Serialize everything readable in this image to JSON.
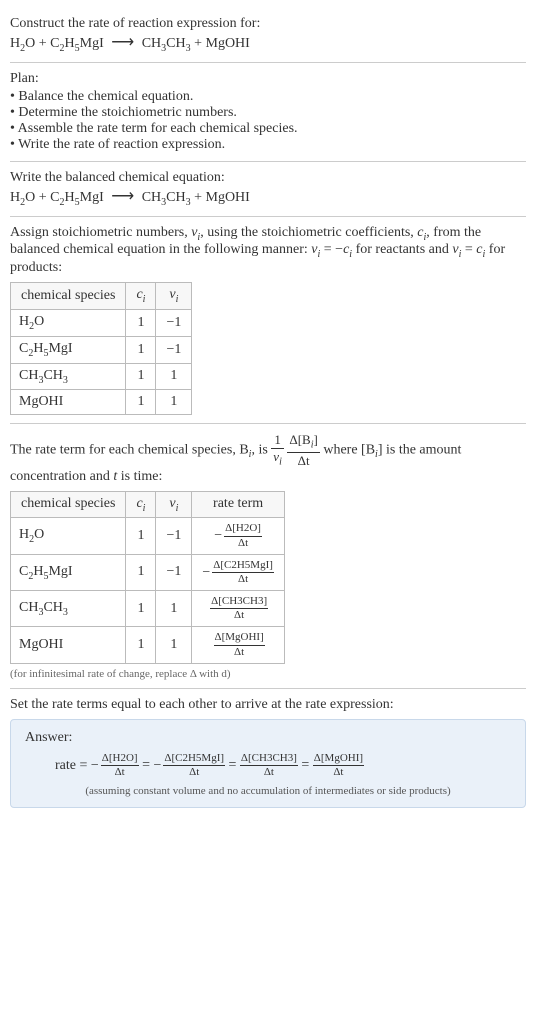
{
  "s1": {
    "heading": "Construct the rate of reaction expression for:",
    "eq_lhs_a": "H",
    "eq_lhs_a_sub": "2",
    "eq_lhs_a_tail": "O",
    "plus1": " + ",
    "eq_lhs_b": "C",
    "eq_lhs_b_sub1": "2",
    "eq_lhs_b_mid": "H",
    "eq_lhs_b_sub2": "5",
    "eq_lhs_b_tail": "MgI",
    "arrow": "⟶",
    "eq_rhs_a": "CH",
    "eq_rhs_a_sub1": "3",
    "eq_rhs_a_mid": "CH",
    "eq_rhs_a_sub2": "3",
    "plus2": " + ",
    "eq_rhs_b": "MgOHI"
  },
  "plan": {
    "heading": "Plan:",
    "items": [
      "Balance the chemical equation.",
      "Determine the stoichiometric numbers.",
      "Assemble the rate term for each chemical species.",
      "Write the rate of reaction expression."
    ]
  },
  "s2": {
    "heading": "Write the balanced chemical equation:"
  },
  "s3": {
    "para_a": "Assign stoichiometric numbers, ",
    "nu": "ν",
    "sub_i": "i",
    "para_b": ", using the stoichiometric coefficients, ",
    "c": "c",
    "para_c": ", from the balanced chemical equation in the following manner: ",
    "eq1_lhs": "ν",
    "eq1_eq": " = −",
    "eq1_rhs": "c",
    "para_d": " for reactants and ",
    "eq2_lhs": "ν",
    "eq2_eq": " = ",
    "eq2_rhs": "c",
    "para_e": " for products:",
    "th1": "chemical species",
    "th2_a": "c",
    "th2_sub": "i",
    "th3_a": "ν",
    "th3_sub": "i",
    "rows": [
      {
        "sp_a": "H",
        "sp_sub1": "2",
        "sp_mid": "O",
        "c": "1",
        "v": "−1"
      },
      {
        "sp_a": "C",
        "sp_sub1": "2",
        "sp_mid": "H",
        "sp_sub2": "5",
        "sp_tail": "MgI",
        "c": "1",
        "v": "−1"
      },
      {
        "sp_a": "CH",
        "sp_sub1": "3",
        "sp_mid": "CH",
        "sp_sub2": "3",
        "c": "1",
        "v": "1"
      },
      {
        "sp_a": "MgOHI",
        "c": "1",
        "v": "1"
      }
    ]
  },
  "s4": {
    "para_a": "The rate term for each chemical species, B",
    "sub_i": "i",
    "para_b": ", is ",
    "frac1_num": "1",
    "frac1_den_a": "ν",
    "frac1_den_sub": "i",
    "frac2_num_a": "Δ[B",
    "frac2_num_sub": "i",
    "frac2_num_b": "]",
    "frac2_den": "Δt",
    "para_c": " where [B",
    "para_d": "] is the amount concentration and ",
    "t": "t",
    "para_e": " is time:",
    "th1": "chemical species",
    "th2_a": "c",
    "th2_sub": "i",
    "th3_a": "ν",
    "th3_sub": "i",
    "th4": "rate term",
    "rows": [
      {
        "sp_a": "H",
        "sp_sub1": "2",
        "sp_mid": "O",
        "c": "1",
        "v": "−1",
        "neg": "−",
        "num": "Δ[H2O]",
        "den": "Δt"
      },
      {
        "sp_a": "C",
        "sp_sub1": "2",
        "sp_mid": "H",
        "sp_sub2": "5",
        "sp_tail": "MgI",
        "c": "1",
        "v": "−1",
        "neg": "−",
        "num": "Δ[C2H5MgI]",
        "den": "Δt"
      },
      {
        "sp_a": "CH",
        "sp_sub1": "3",
        "sp_mid": "CH",
        "sp_sub2": "3",
        "c": "1",
        "v": "1",
        "neg": "",
        "num": "Δ[CH3CH3]",
        "den": "Δt"
      },
      {
        "sp_a": "MgOHI",
        "c": "1",
        "v": "1",
        "neg": "",
        "num": "Δ[MgOHI]",
        "den": "Δt"
      }
    ],
    "note": "(for infinitesimal rate of change, replace Δ with d)"
  },
  "s5": {
    "heading": "Set the rate terms equal to each other to arrive at the rate expression:"
  },
  "answer": {
    "label": "Answer:",
    "rate_word": "rate = ",
    "neg": "−",
    "eq": " = ",
    "t1_num": "Δ[H2O]",
    "t1_den": "Δt",
    "t2_num": "Δ[C2H5MgI]",
    "t2_den": "Δt",
    "t3_num": "Δ[CH3CH3]",
    "t3_den": "Δt",
    "t4_num": "Δ[MgOHI]",
    "t4_den": "Δt",
    "note": "(assuming constant volume and no accumulation of intermediates or side products)"
  },
  "chart_data": {
    "type": "table",
    "tables": [
      {
        "title": "Stoichiometric numbers",
        "columns": [
          "chemical species",
          "c_i",
          "ν_i"
        ],
        "rows": [
          [
            "H2O",
            1,
            -1
          ],
          [
            "C2H5MgI",
            1,
            -1
          ],
          [
            "CH3CH3",
            1,
            1
          ],
          [
            "MgOHI",
            1,
            1
          ]
        ]
      },
      {
        "title": "Rate terms",
        "columns": [
          "chemical species",
          "c_i",
          "ν_i",
          "rate term"
        ],
        "rows": [
          [
            "H2O",
            1,
            -1,
            "-Δ[H2O]/Δt"
          ],
          [
            "C2H5MgI",
            1,
            -1,
            "-Δ[C2H5MgI]/Δt"
          ],
          [
            "CH3CH3",
            1,
            1,
            "Δ[CH3CH3]/Δt"
          ],
          [
            "MgOHI",
            1,
            1,
            "Δ[MgOHI]/Δt"
          ]
        ]
      }
    ]
  }
}
